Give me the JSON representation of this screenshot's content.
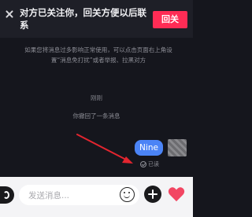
{
  "banner": {
    "message": "对方已关注你，回关方便以后联系",
    "follow_back_label": "回关"
  },
  "chat": {
    "notice": "如果您将消息过多影响正常使用，可以点击页面右上角设置“消息免打扰”或者举报、拉黑对方",
    "timestamp": "刚刚",
    "recall_notice": "你撤回了一条消息",
    "messages": [
      {
        "text": "Nine",
        "status": "已读"
      }
    ]
  },
  "composer": {
    "placeholder": "发送消息..."
  },
  "icons": {
    "close": "close-icon",
    "voice": "voice-icon",
    "emoji": "emoji-icon",
    "plus": "plus-icon",
    "heart": "heart-icon",
    "arrow": "arrow-annotation"
  },
  "colors": {
    "accent_red": "#fe2c55",
    "bubble_blue": "#4b84f6",
    "background": "#15161d"
  }
}
